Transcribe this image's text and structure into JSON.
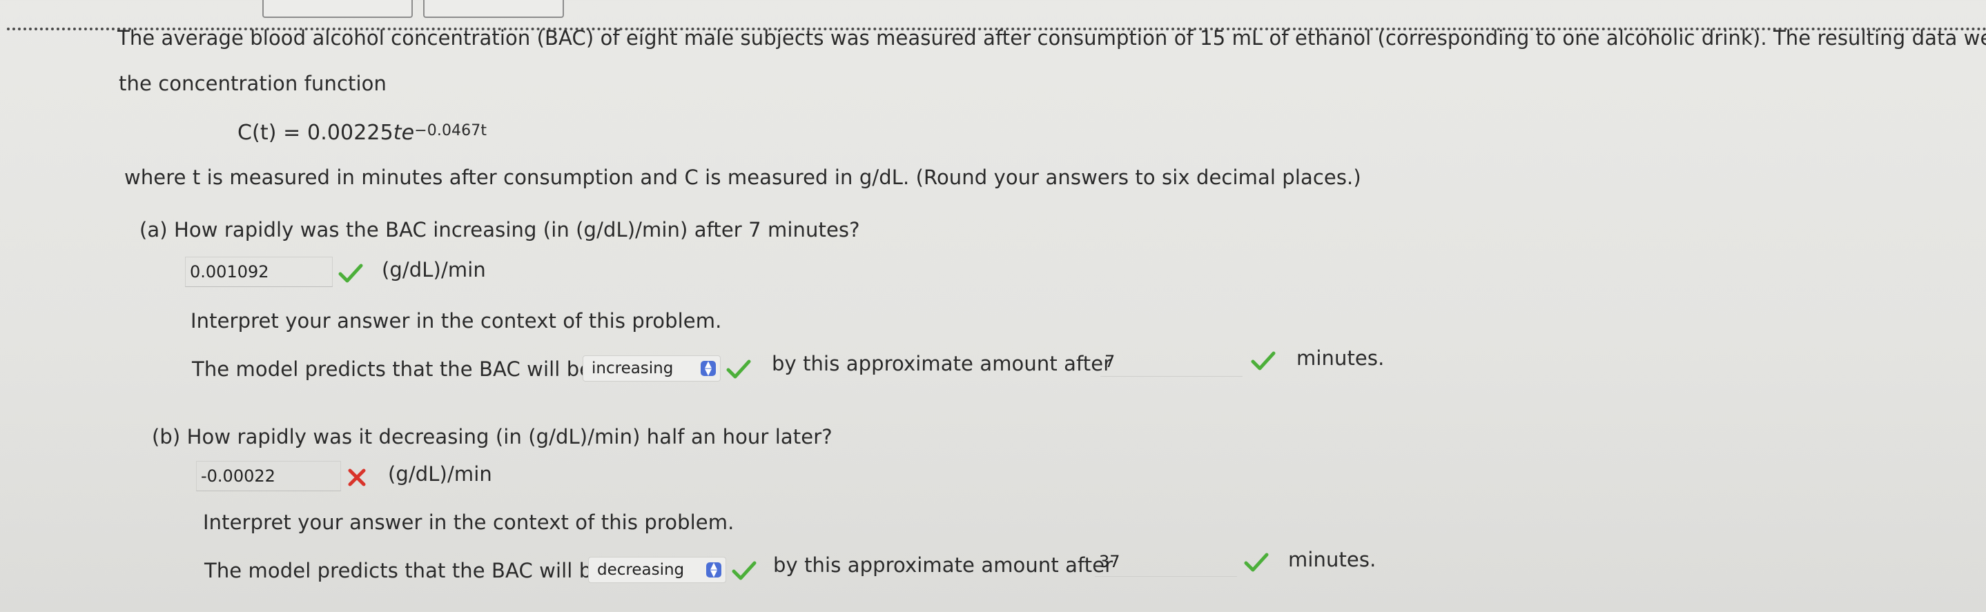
{
  "problem": {
    "intro_line1": "The average blood alcohol concentration (BAC) of eight male subjects was measured after consumption of 15 mL of ethanol (corresponding to one alcoholic drink). The resulting data were",
    "intro_line2": "the concentration function",
    "formula_lhs": "C(t) = 0.00225",
    "formula_var": "t",
    "formula_base": "e",
    "formula_exp": "−0.0467t",
    "where_line": "where t is measured in minutes after consumption and C is measured in g/dL. (Round your answers to six decimal places.)"
  },
  "part_a": {
    "question": "(a)   How rapidly was the BAC increasing (in (g/dL)/min) after 7 minutes?",
    "answer_value": "0.001092",
    "answer_status": "correct",
    "unit": "(g/dL)/min",
    "interpret_prompt": "Interpret your answer in the context of this problem.",
    "sentence_start": "The model predicts that the BAC will be",
    "select_value": "increasing",
    "select_status": "correct",
    "sentence_mid": "by this approximate amount after",
    "minutes_value": "7",
    "minutes_status": "correct",
    "sentence_end": "minutes."
  },
  "part_b": {
    "question": "(b)   How rapidly was it decreasing (in (g/dL)/min) half an hour later?",
    "answer_value": "-0.00022",
    "answer_status": "incorrect",
    "unit": "(g/dL)/min",
    "interpret_prompt": "Interpret your answer in the context of this problem.",
    "sentence_start": "The model predicts that the BAC will be",
    "select_value": "decreasing",
    "select_status": "correct",
    "sentence_mid": "by this approximate amount after",
    "minutes_value": "37",
    "minutes_status": "correct",
    "sentence_end": "minutes."
  },
  "colors": {
    "correct": "#4caf3a",
    "incorrect": "#d9342b",
    "select_arrow": "#4b6fd6"
  },
  "icons": {
    "correct": "checkmark-icon",
    "incorrect": "x-mark-icon",
    "select": "updown-chevron-icon"
  }
}
